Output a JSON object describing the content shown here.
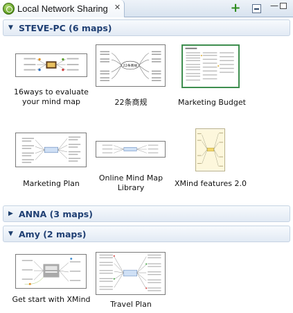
{
  "window": {
    "tab_title": "Local Network Sharing",
    "close_glyph": "✕",
    "add_glyph": "+",
    "minimize_glyph": "—"
  },
  "sections": [
    {
      "title": "STEVE-PC (6 maps)",
      "expanded": true,
      "maps": [
        {
          "name": "16ways to evaluate your mind map",
          "selected": false
        },
        {
          "name": "22条商规",
          "selected": false
        },
        {
          "name": "Marketing Budget",
          "selected": true
        },
        {
          "name": "Marketing Plan",
          "selected": false
        },
        {
          "name": "Online Mind Map Library",
          "selected": false
        },
        {
          "name": "XMind features 2.0",
          "selected": false
        }
      ]
    },
    {
      "title": "ANNA (3 maps)",
      "expanded": false,
      "maps": []
    },
    {
      "title": "Amy (2 maps)",
      "expanded": true,
      "maps": [
        {
          "name": "Get start with XMind",
          "selected": false
        },
        {
          "name": "Travel Plan",
          "selected": false
        }
      ]
    }
  ],
  "thumbnail_texts": {
    "map2_center": "22条商规"
  },
  "icons": {
    "tab": "xmind-share-icon",
    "expanded_arrow": "▼",
    "collapsed_arrow": "▶"
  },
  "colors": {
    "section_title": "#1f3f73",
    "selected_border": "#3e8e4f",
    "add_button": "#2e8b1e"
  }
}
